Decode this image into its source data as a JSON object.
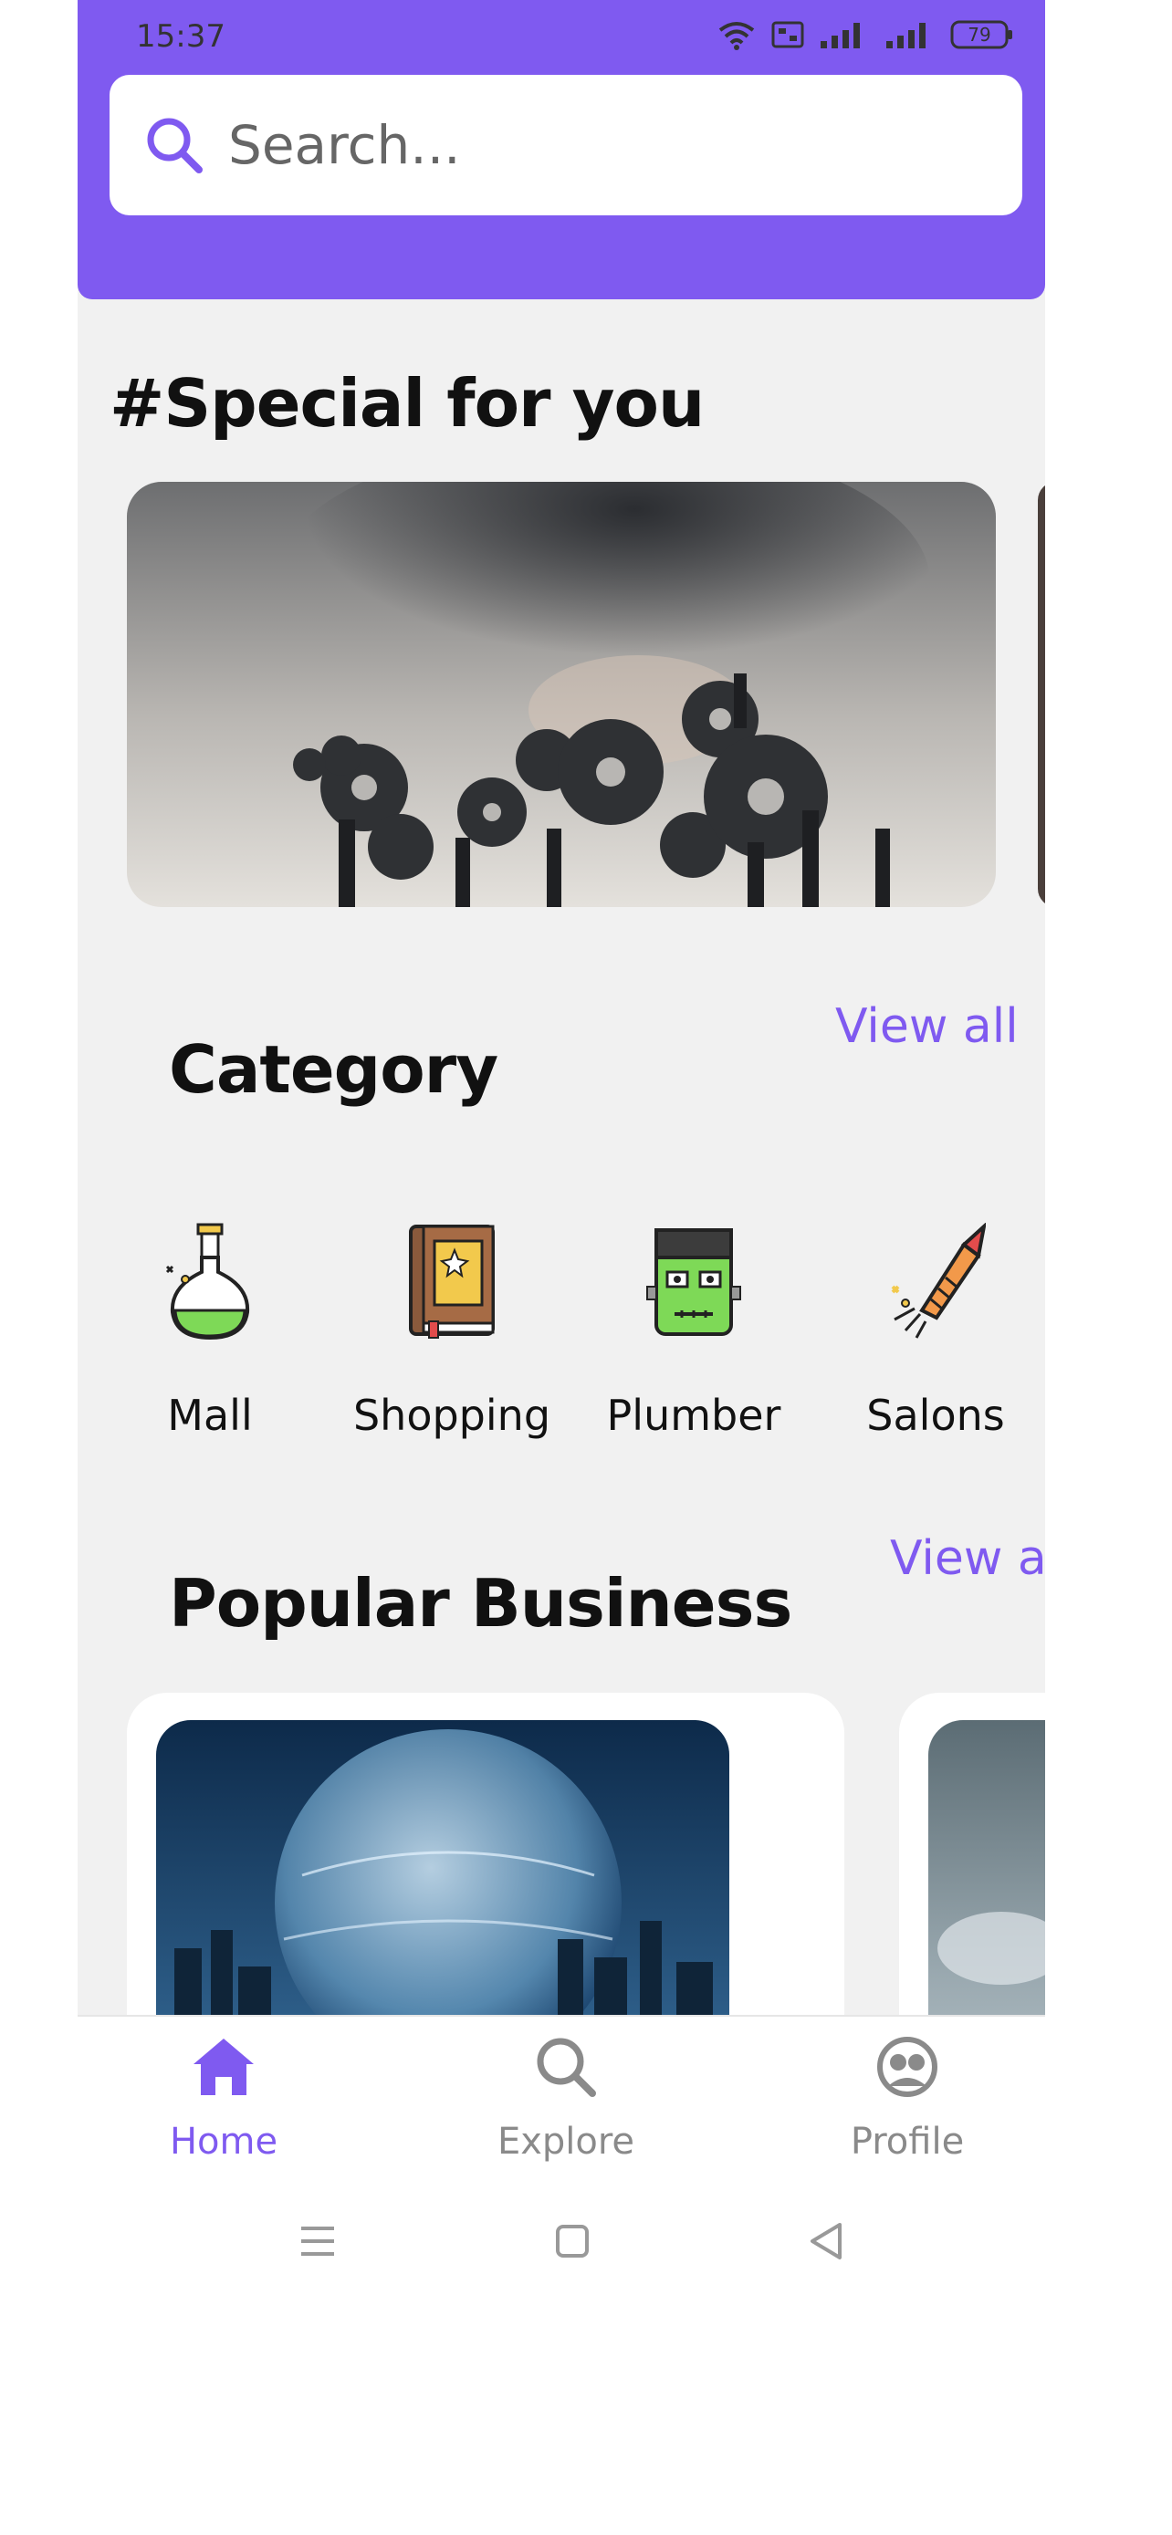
{
  "status_bar": {
    "time": "15:37",
    "battery": "79"
  },
  "search": {
    "placeholder": "Search..."
  },
  "special": {
    "title": "#Special for you"
  },
  "category": {
    "title": "Category",
    "view_all": "View all",
    "items": [
      {
        "label": "Mall",
        "icon": "potion-flask-icon"
      },
      {
        "label": "Shopping",
        "icon": "book-icon"
      },
      {
        "label": "Plumber",
        "icon": "frankenstein-icon"
      },
      {
        "label": "Salons",
        "icon": "firework-rocket-icon"
      }
    ]
  },
  "popular": {
    "title": "Popular Business",
    "view_all": "View all"
  },
  "bottom_nav": {
    "items": [
      {
        "label": "Home",
        "icon": "home-icon",
        "active": true
      },
      {
        "label": "Explore",
        "icon": "search-icon",
        "active": false
      },
      {
        "label": "Profile",
        "icon": "profile-icon",
        "active": false
      }
    ]
  },
  "colors": {
    "accent": "#7f5af0",
    "background": "#f1f1f1",
    "inactive": "#8a8a8a"
  }
}
